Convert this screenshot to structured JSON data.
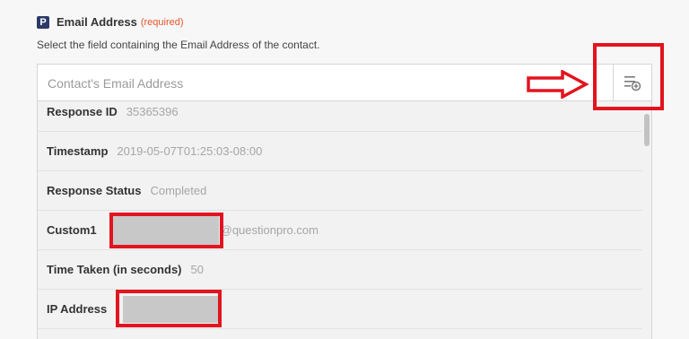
{
  "field": {
    "app_badge": "P",
    "label": "Email Address",
    "required": "(required)",
    "help": "Select the field containing the Email Address of the contact."
  },
  "input": {
    "placeholder": "Contact's Email Address",
    "picker_icon": "list-add-icon"
  },
  "options": [
    {
      "label": "Response ID",
      "value": "35365396"
    },
    {
      "label": "Timestamp",
      "value": "2019-05-07T01:25:03-08:00"
    },
    {
      "label": "Response Status",
      "value": "Completed"
    },
    {
      "label": "Custom1",
      "value": "@questionpro.com"
    },
    {
      "label": "Time Taken (in seconds)",
      "value": "50"
    },
    {
      "label": "IP Address",
      "value": ""
    }
  ],
  "colors": {
    "annotation_red": "#e2141f",
    "required_orange": "#e8542a",
    "badge_navy": "#2b3a67"
  }
}
